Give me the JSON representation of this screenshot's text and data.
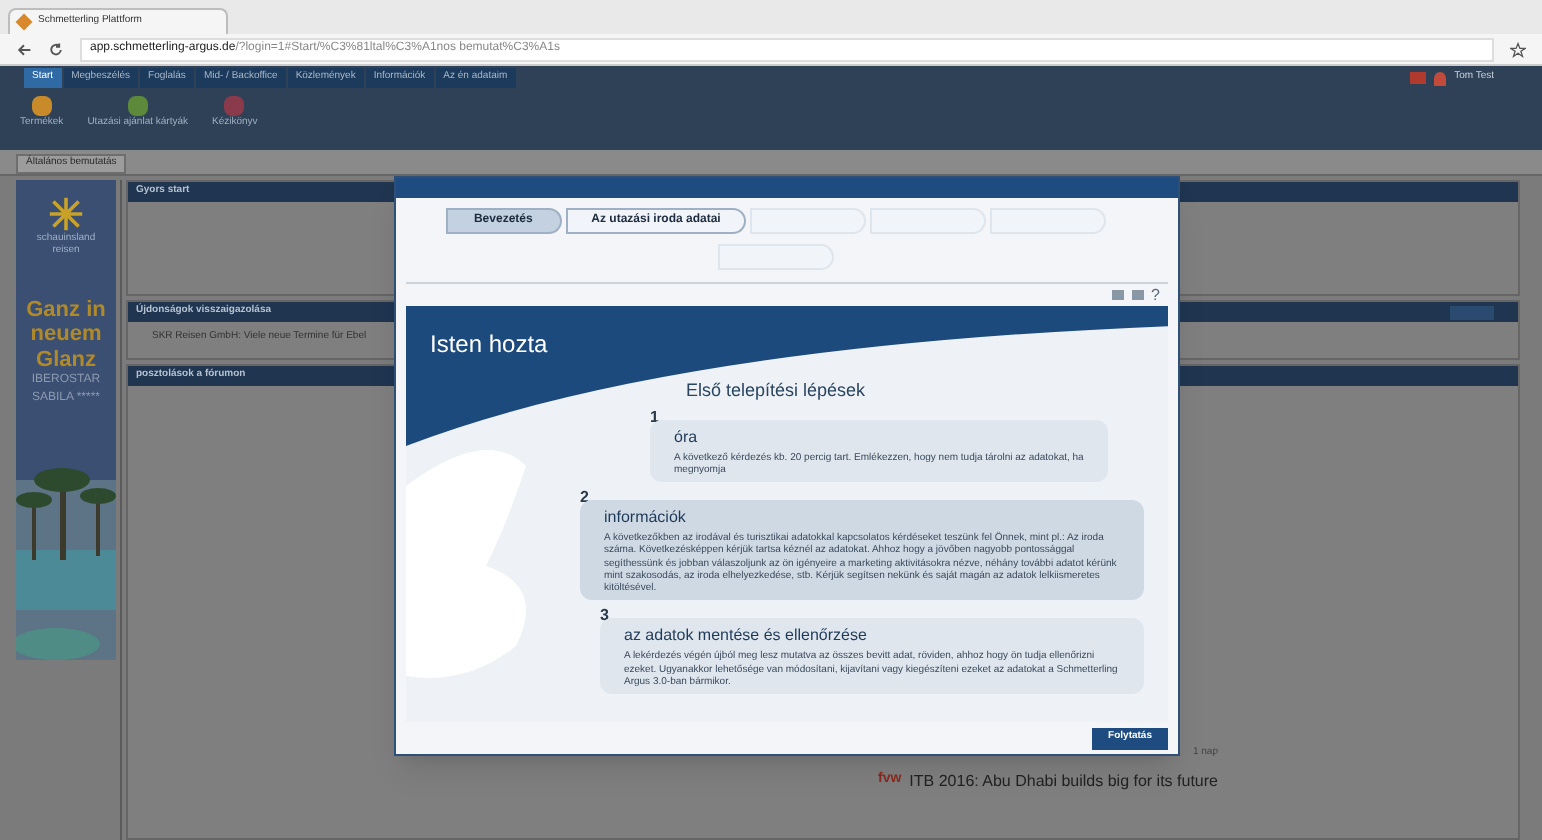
{
  "browser": {
    "tab_title": "Schmetterling Plattform",
    "url_host": "app.schmetterling-argus.de",
    "url_path": "/?login=1#Start/%C3%81ltal%C3%A1nos bemutat%C3%A1s"
  },
  "menu": [
    {
      "label": "Start",
      "selected": true
    },
    {
      "label": "Megbeszélés",
      "selected": false
    },
    {
      "label": "Foglalás",
      "selected": false
    },
    {
      "label": "Mid- / Backoffice",
      "selected": false
    },
    {
      "label": "Közlemények",
      "selected": false
    },
    {
      "label": "Információk",
      "selected": false
    },
    {
      "label": "Az én adataim",
      "selected": false
    }
  ],
  "user": {
    "name": "Tom Test"
  },
  "toolbar": [
    {
      "label": "Termékek"
    },
    {
      "label": "Utazási ajánlat kártyák"
    },
    {
      "label": "Kézikönyv"
    }
  ],
  "page_tabs": [
    {
      "label": "Általános bemutatás"
    }
  ],
  "ad": {
    "brand": "schauinsland reisen",
    "headline": "Ganz in neuem Glanz",
    "hotel": "IBEROSTAR",
    "sub": "SABILA *****"
  },
  "panels": [
    {
      "title": "Gyors start"
    },
    {
      "title": "Újdonságok visszaigazolása",
      "items": [
        "SKR Reisen GmbH: Viele neue Termine für Ebel"
      ]
    },
    {
      "title": "posztolások a fórumon"
    }
  ],
  "feed": {
    "age": "1 nap",
    "source": "fvw",
    "headline": "ITB 2016: Abu Dhabi builds big for its future"
  },
  "wizard": {
    "steps": [
      {
        "label": "Bevezetés",
        "selected": true,
        "disabled": false
      },
      {
        "label": "Az utazási iroda adatai",
        "selected": false,
        "disabled": false
      },
      {
        "selected": false,
        "disabled": true
      },
      {
        "selected": false,
        "disabled": true
      },
      {
        "selected": false,
        "disabled": true
      },
      {
        "selected": false,
        "disabled": true
      }
    ],
    "help": "?",
    "welcome": "Isten hozta",
    "heading": "Első telepítési lépések",
    "sections": [
      {
        "number": "1",
        "title": "óra",
        "text": "A következő kérdezés kb. 20 percig tart. Emlékezzen, hogy nem tudja tárolni az adatokat, ha megnyomja"
      },
      {
        "number": "2",
        "title": "információk",
        "text": "A következőkben az irodával és turisztikai adatokkal kapcsolatos kérdéseket teszünk fel Önnek, mint pl.: Az iroda száma. Következésképpen kérjük tartsa kéznél az adatokat. Ahhoz hogy a jövőben nagyobb pontossággal segíthessünk és jobban válaszoljunk az ön igényeire a marketing aktivitásokra nézve, néhány további adatot kérünk mint szakosodás, az iroda elhelyezkedése, stb. Kérjük segítsen nekünk és saját magán az adatok lelkiismeretes kitöltésével."
      },
      {
        "number": "3",
        "title": "az adatok mentése és ellenőrzése",
        "text": "A lekérdezés végén újból meg lesz mutatva az összes bevitt adat, röviden, ahhoz hogy ön tudja ellenőrizni ezeket. Ugyanakkor lehetősége van módosítani, kijavítani vagy kiegészíteni ezeket az adatokat a Schmetterling Argus 3.0-ban bármikor."
      }
    ],
    "continue": "Folytatás"
  }
}
